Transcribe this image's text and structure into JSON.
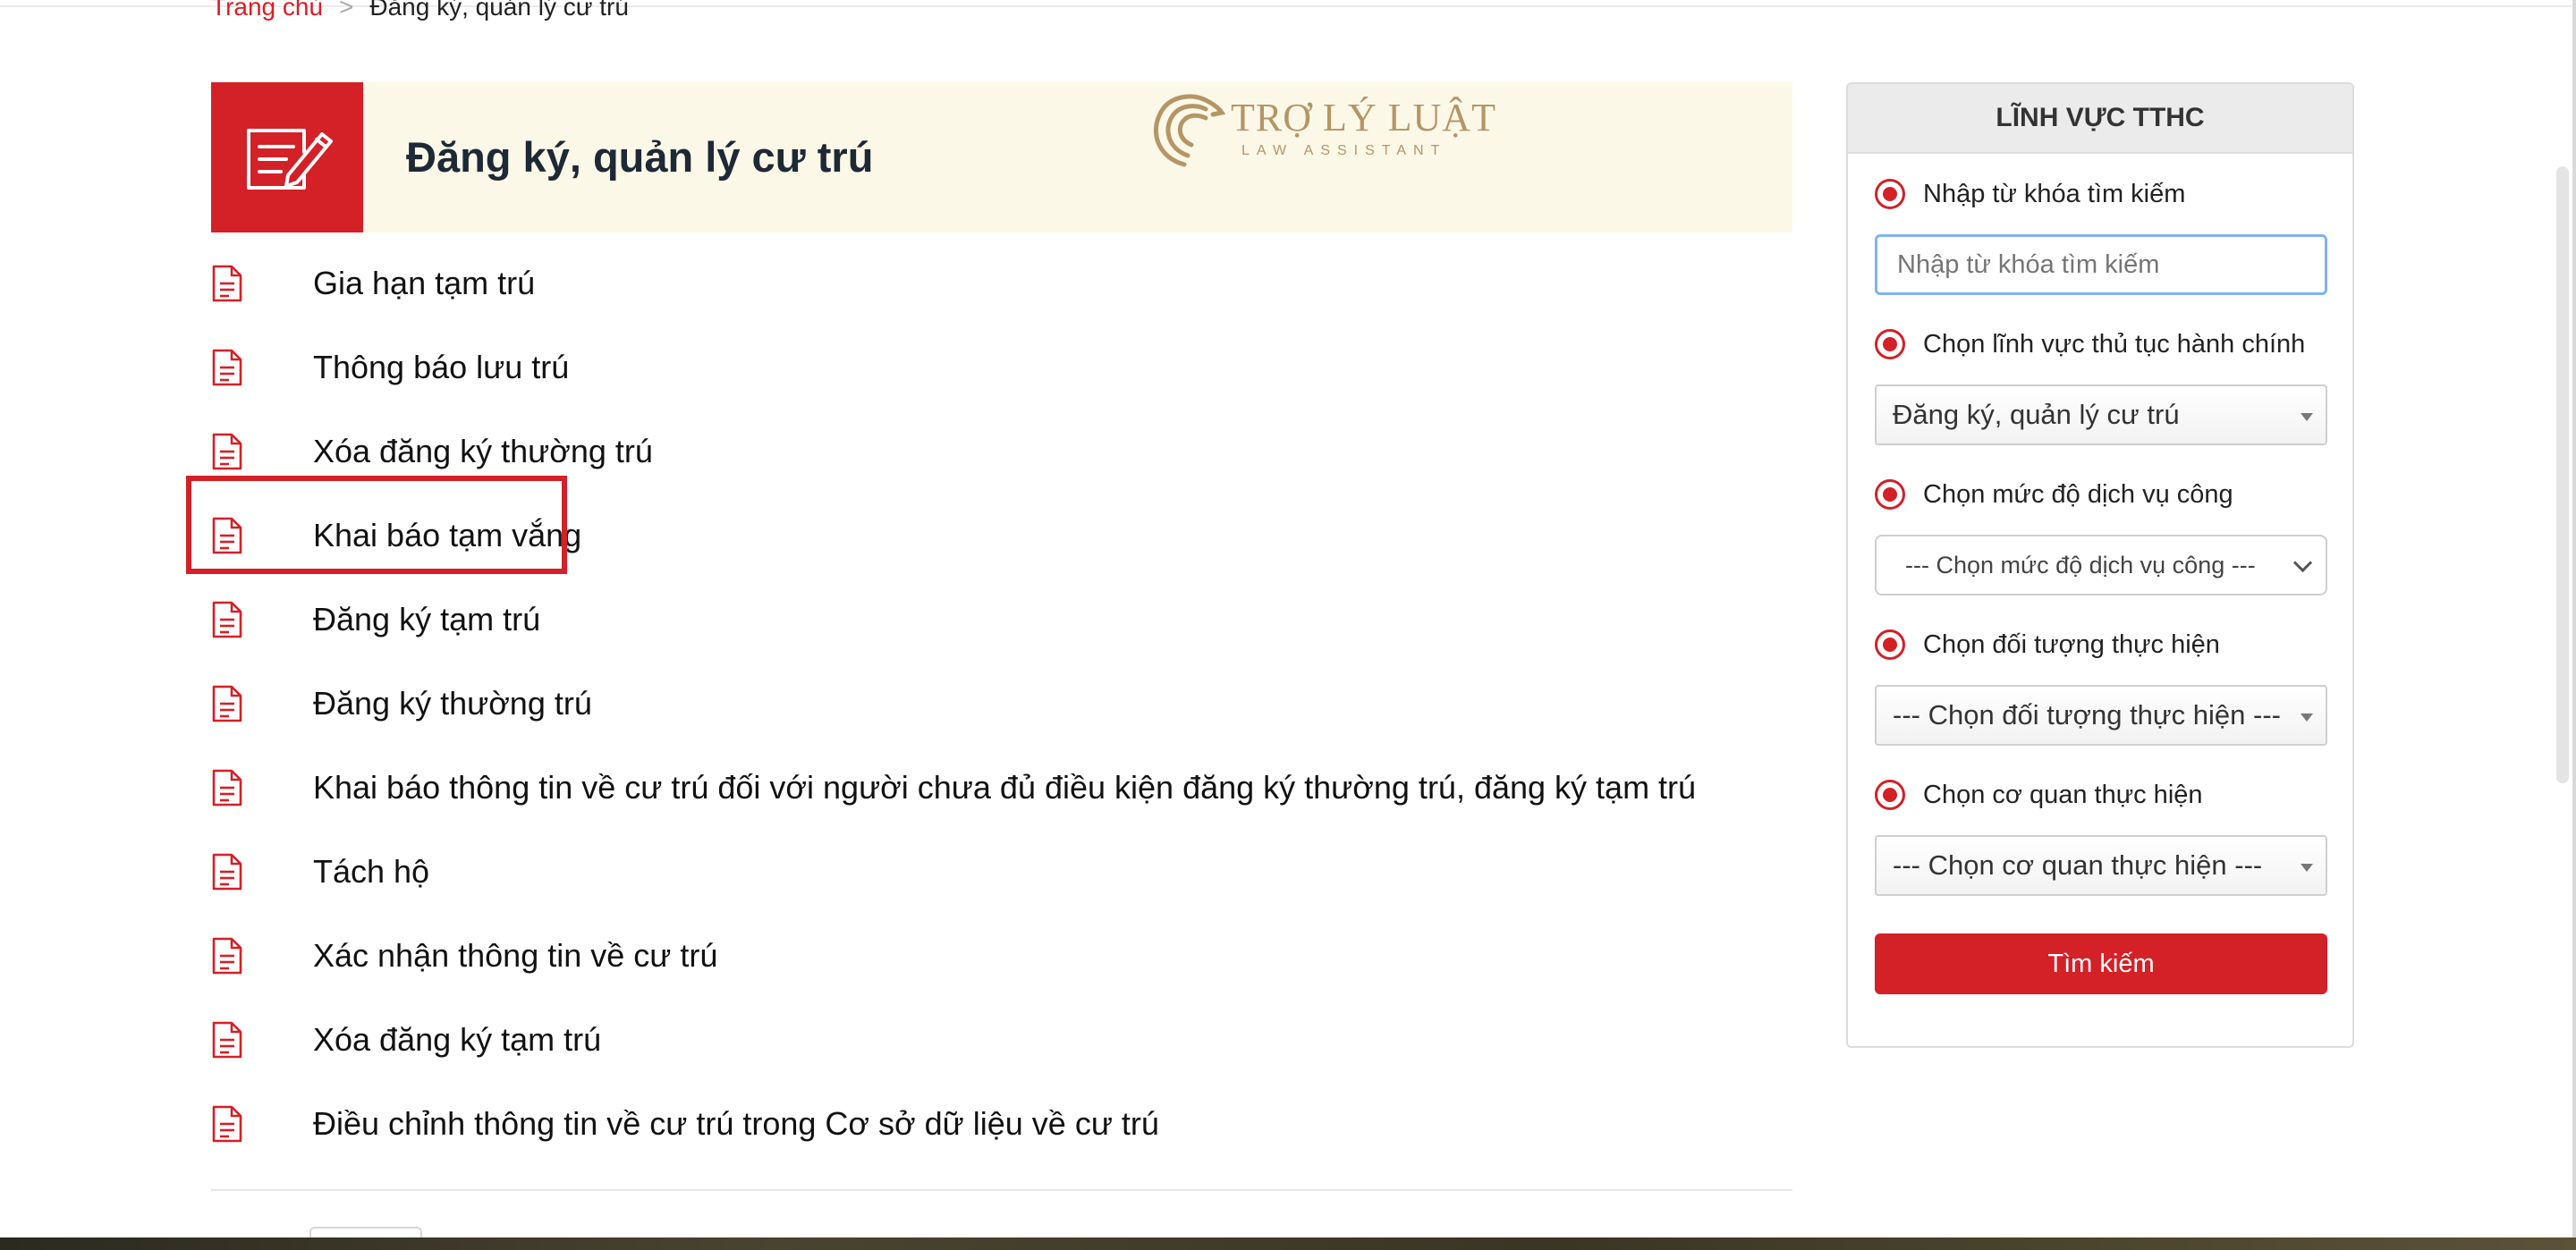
{
  "breadcrumb": {
    "home": "Trang chủ",
    "separator": ">",
    "current": "Đăng ký, quản lý cư trú"
  },
  "banner": {
    "title": "Đăng ký, quản lý cư trú",
    "icon": "edit-document-icon",
    "logo": {
      "name": "TRỢ LÝ LUẬT",
      "tagline": "LAW ASSISTANT"
    }
  },
  "procedures": [
    {
      "label": "Gia hạn tạm trú"
    },
    {
      "label": "Thông báo lưu trú"
    },
    {
      "label": "Xóa đăng ký thường trú"
    },
    {
      "label": "Khai báo tạm vắng",
      "highlighted": true
    },
    {
      "label": "Đăng ký tạm trú"
    },
    {
      "label": "Đăng ký thường trú"
    },
    {
      "label": "Khai báo thông tin về cư trú đối với người chưa đủ điều kiện đăng ký thường trú, đăng ký tạm trú"
    },
    {
      "label": "Tách hộ"
    },
    {
      "label": "Xác nhận thông tin về cư trú"
    },
    {
      "label": "Xóa đăng ký tạm trú"
    },
    {
      "label": "Điều chỉnh thông tin về cư trú trong Cơ sở dữ liệu về cư trú"
    }
  ],
  "sidebar": {
    "title": "LĨNH VỰC TTHC",
    "keyword": {
      "label": "Nhập từ khóa tìm kiếm",
      "placeholder": "Nhập từ khóa tìm kiếm",
      "value": ""
    },
    "field": {
      "label": "Chọn lĩnh vực thủ tục hành chính",
      "selected": "Đăng ký, quản lý cư trú"
    },
    "level": {
      "label": "Chọn mức độ dịch vụ công",
      "selected": "--- Chọn mức độ dịch vụ công ---"
    },
    "subject": {
      "label": "Chọn đối tượng thực hiện",
      "selected": "--- Chọn đối tượng thực hiện ---"
    },
    "agency": {
      "label": "Chọn cơ quan thực hiện",
      "selected": "--- Chọn cơ quan thực hiện ---"
    },
    "search_button": "Tìm kiếm"
  },
  "colors": {
    "accent": "#d42027",
    "banner_bg": "#fbf8e8",
    "logo_gold": "#b59566"
  }
}
